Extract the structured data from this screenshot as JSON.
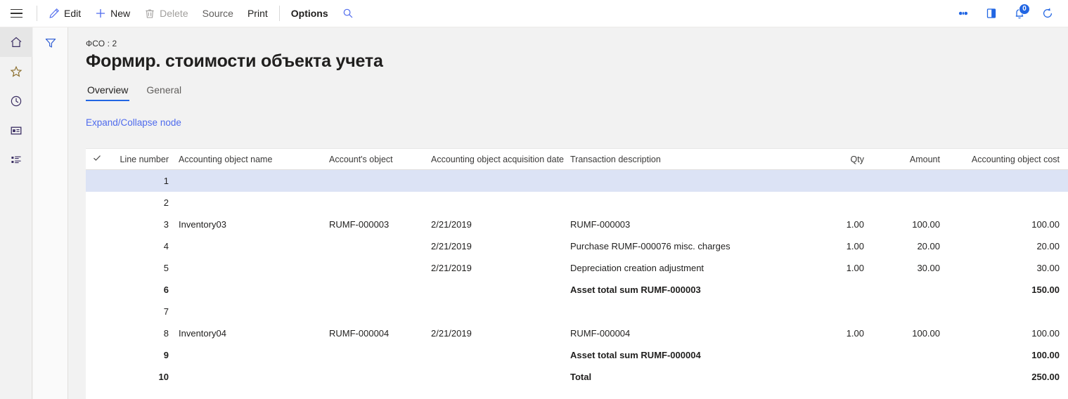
{
  "toolbar": {
    "menu_icon": "hamburger-icon",
    "items": [
      {
        "label": "Edit",
        "icon": "pencil-icon",
        "state": "enabled"
      },
      {
        "label": "New",
        "icon": "plus-icon",
        "state": "enabled"
      },
      {
        "label": "Delete",
        "icon": "trash-icon",
        "state": "disabled"
      },
      {
        "label": "Source",
        "icon": "",
        "state": "muted"
      },
      {
        "label": "Print",
        "icon": "",
        "state": "enabled"
      },
      {
        "label": "Options",
        "icon": "",
        "state": "bold"
      }
    ],
    "search_icon": "search-icon",
    "right_icons": [
      {
        "name": "settings-gear-icon"
      },
      {
        "name": "help-book-icon"
      },
      {
        "name": "notifications-bell-icon",
        "badge": "0"
      },
      {
        "name": "refresh-icon"
      }
    ]
  },
  "navrail": {
    "items": [
      {
        "name": "home-icon",
        "label": "Home",
        "active": true
      },
      {
        "name": "favorites-icon",
        "label": "Favorites",
        "active": false
      },
      {
        "name": "recent-icon",
        "label": "Recent",
        "active": false
      },
      {
        "name": "workspaces-icon",
        "label": "Workspaces",
        "active": false
      },
      {
        "name": "modules-icon",
        "label": "Modules",
        "active": false
      }
    ]
  },
  "filter_pane": {
    "icon": "filter-funnel-icon",
    "label": "Filter"
  },
  "page": {
    "caption": "ФСО : 2",
    "title": "Формир. стоимости объекта учета",
    "tabs": [
      {
        "label": "Overview",
        "active": true
      },
      {
        "label": "General",
        "active": false
      }
    ],
    "node_link": "Expand/Collapse node"
  },
  "grid": {
    "select_all_icon": "checkmark-icon",
    "columns": [
      "Line number",
      "Accounting object name",
      "Account's object",
      "Accounting object acquisition date",
      "Transaction description",
      "Qty",
      "Amount",
      "Accounting object cost"
    ],
    "rows": [
      {
        "line": "1",
        "name": "",
        "account": "",
        "date": "",
        "description": "",
        "qty": "",
        "amount": "",
        "cost": "",
        "bold": false,
        "selected": true
      },
      {
        "line": "2",
        "name": "",
        "account": "",
        "date": "",
        "description": "",
        "qty": "",
        "amount": "",
        "cost": "",
        "bold": false,
        "selected": false
      },
      {
        "line": "3",
        "name": "Inventory03",
        "account": "RUMF-000003",
        "date": "2/21/2019",
        "description": "RUMF-000003",
        "qty": "1.00",
        "amount": "100.00",
        "cost": "100.00",
        "bold": false,
        "selected": false
      },
      {
        "line": "4",
        "name": "",
        "account": "",
        "date": "2/21/2019",
        "description": "Purchase RUMF-000076 misc. charges",
        "qty": "1.00",
        "amount": "20.00",
        "cost": "20.00",
        "bold": false,
        "selected": false
      },
      {
        "line": "5",
        "name": "",
        "account": "",
        "date": "2/21/2019",
        "description": "Depreciation creation adjustment",
        "qty": "1.00",
        "amount": "30.00",
        "cost": "30.00",
        "bold": false,
        "selected": false
      },
      {
        "line": "6",
        "name": "",
        "account": "",
        "date": "",
        "description": "Asset total sum RUMF-000003",
        "qty": "",
        "amount": "",
        "cost": "150.00",
        "bold": true,
        "selected": false
      },
      {
        "line": "7",
        "name": "",
        "account": "",
        "date": "",
        "description": "",
        "qty": "",
        "amount": "",
        "cost": "",
        "bold": false,
        "selected": false
      },
      {
        "line": "8",
        "name": "Inventory04",
        "account": "RUMF-000004",
        "date": "2/21/2019",
        "description": "RUMF-000004",
        "qty": "1.00",
        "amount": "100.00",
        "cost": "100.00",
        "bold": false,
        "selected": false
      },
      {
        "line": "9",
        "name": "",
        "account": "",
        "date": "",
        "description": "Asset total sum RUMF-000004",
        "qty": "",
        "amount": "",
        "cost": "100.00",
        "bold": true,
        "selected": false
      },
      {
        "line": "10",
        "name": "",
        "account": "",
        "date": "",
        "description": "Total",
        "qty": "",
        "amount": "",
        "cost": "250.00",
        "bold": true,
        "selected": false
      }
    ]
  },
  "colors": {
    "accent": "#2266e3",
    "link": "#4f6bed",
    "selection": "#dce3f5",
    "page_bg": "#f2f2f2",
    "text": "#201f1e"
  }
}
